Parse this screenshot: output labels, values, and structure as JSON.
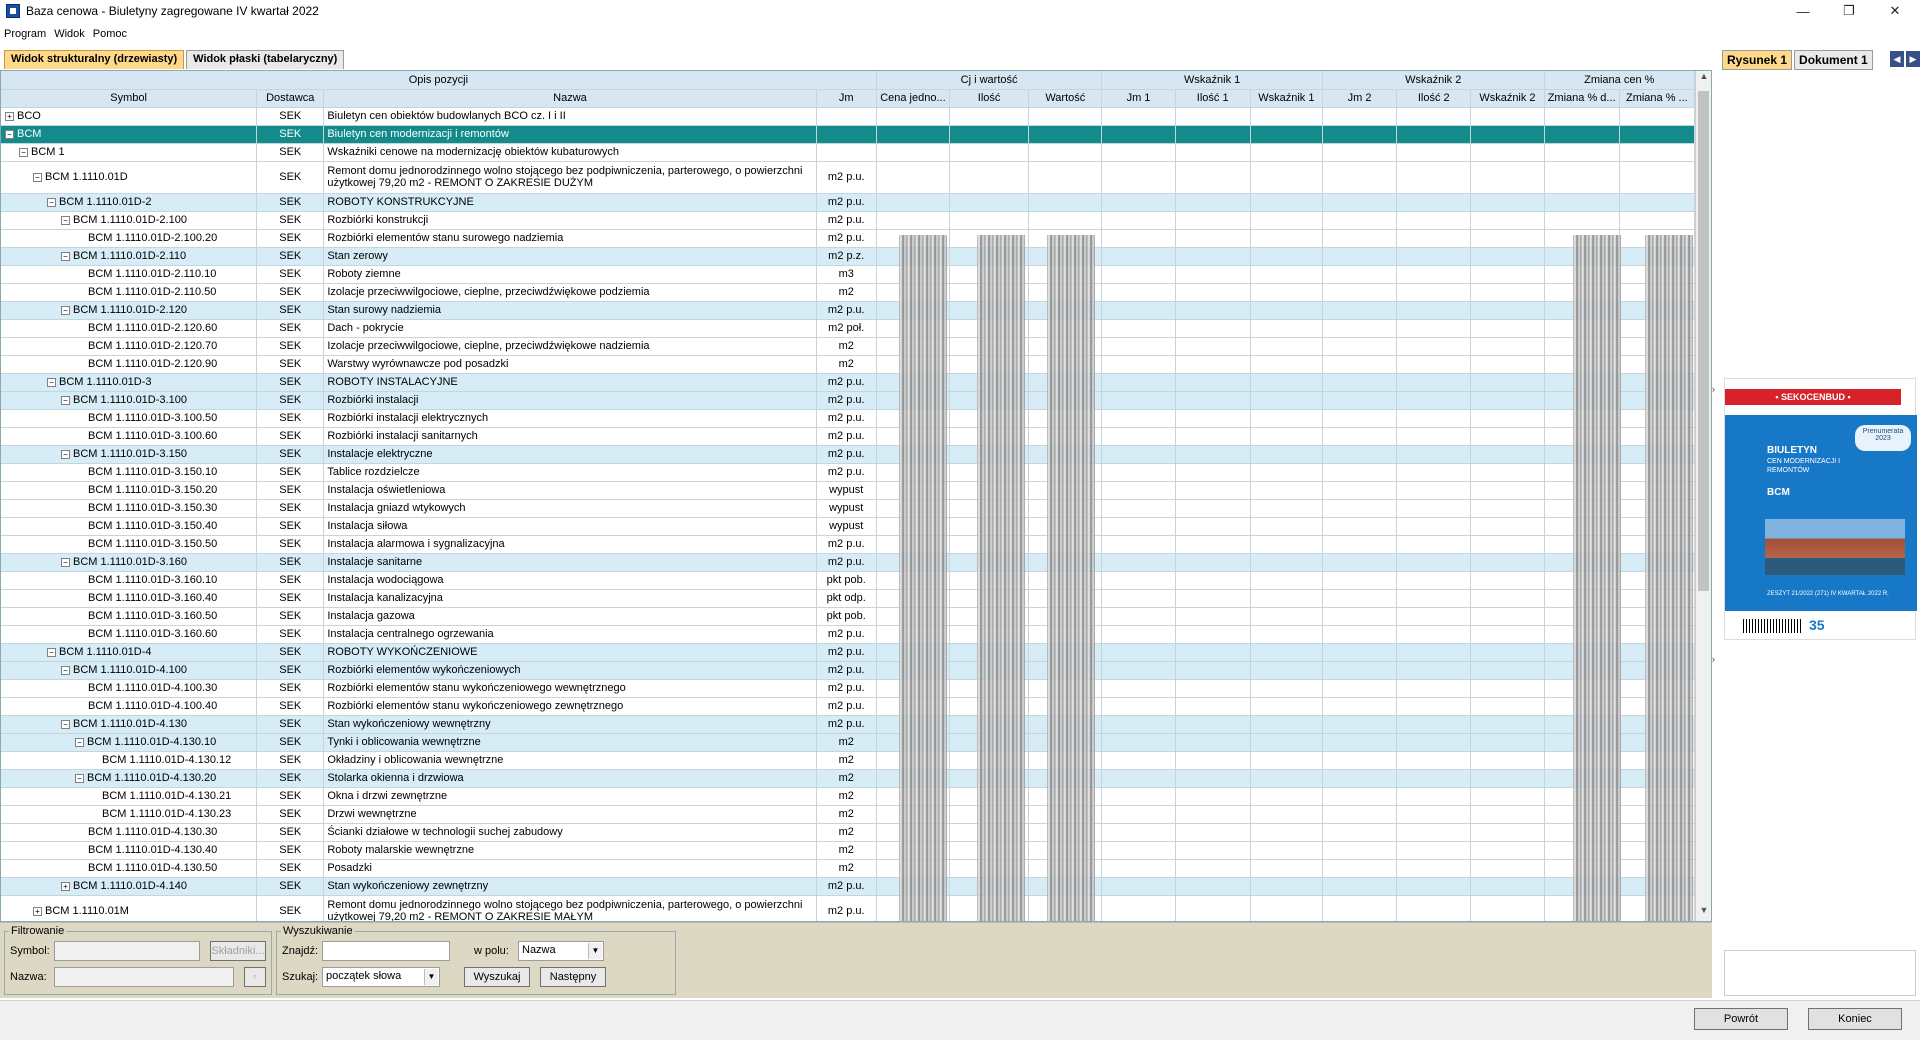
{
  "window": {
    "title": "Baza cenowa - Biuletyny zagregowane IV kwartał 2022",
    "controls": {
      "minimize": "—",
      "maximize": "❐",
      "close": "✕"
    }
  },
  "menu": [
    "Program",
    "Widok",
    "Pomoc"
  ],
  "tabs": [
    "Widok strukturalny (drzewiasty)",
    "Widok płaski (tabelaryczny)"
  ],
  "grid": {
    "group_headers": {
      "opis": "Opis pozycji",
      "cj": "Cj i wartość",
      "wsk1": "Wskaźnik 1",
      "wsk2": "Wskaźnik 2",
      "zmiana": "Zmiana cen %"
    },
    "columns": [
      "Symbol",
      "Dostawca",
      "Nazwa",
      "Jm",
      "Cena jedno...",
      "Ilość",
      "Wartość",
      "Jm 1",
      "Ilość 1",
      "Wskaźnik 1",
      "Jm 2",
      "Ilość 2",
      "Wskaźnik 2",
      "Zmiana % d...",
      "Zmiana % ..."
    ],
    "rows": [
      {
        "symbol": "BCO",
        "dostawca": "SEK",
        "nazwa": "Biuletyn cen obiektów budowlanych BCO cz. I i II",
        "jm": "",
        "exp": "+",
        "style": "row",
        "lvl": 0
      },
      {
        "symbol": "BCM",
        "dostawca": "SEK",
        "nazwa": "Biuletyn cen modernizacji i remontów",
        "jm": "",
        "exp": "−",
        "style": "sel",
        "lvl": 0
      },
      {
        "symbol": "BCM 1",
        "dostawca": "SEK",
        "nazwa": "Wskaźniki cenowe na modernizację obiektów kubaturowych",
        "jm": "",
        "exp": "−",
        "style": "row",
        "lvl": 1
      },
      {
        "symbol": "BCM 1.1110.01D",
        "dostawca": "SEK",
        "nazwa": "Remont domu jednorodzinnego wolno stojącego bez podpiwniczenia, parterowego, o powierzchni użytkowej 79,20 m2 - REMONT O ZAKRESIE DUŻYM",
        "jm": "m2 p.u.",
        "exp": "−",
        "style": "row tall",
        "lvl": 2
      },
      {
        "symbol": "BCM 1.1110.01D-2",
        "dostawca": "SEK",
        "nazwa": "ROBOTY KONSTRUKCYJNE",
        "jm": "m2 p.u.",
        "exp": "−",
        "style": "group",
        "lvl": 3
      },
      {
        "symbol": "BCM 1.1110.01D-2.100",
        "dostawca": "SEK",
        "nazwa": "Rozbiórki konstrukcji",
        "jm": "m2 p.u.",
        "exp": "−",
        "style": "row",
        "lvl": 4
      },
      {
        "symbol": "BCM 1.1110.01D-2.100.20",
        "dostawca": "SEK",
        "nazwa": "Rozbiórki elementów stanu surowego nadziemia",
        "jm": "m2 p.u.",
        "exp": "",
        "style": "row",
        "lvl": 5
      },
      {
        "symbol": "BCM 1.1110.01D-2.110",
        "dostawca": "SEK",
        "nazwa": "Stan zerowy",
        "jm": "m2 p.z.",
        "exp": "−",
        "style": "group",
        "lvl": 4
      },
      {
        "symbol": "BCM 1.1110.01D-2.110.10",
        "dostawca": "SEK",
        "nazwa": "Roboty ziemne",
        "jm": "m3",
        "exp": "",
        "style": "row",
        "lvl": 5
      },
      {
        "symbol": "BCM 1.1110.01D-2.110.50",
        "dostawca": "SEK",
        "nazwa": "Izolacje przeciwwilgociowe, cieplne, przeciwdźwiękowe podziemia",
        "jm": "m2",
        "exp": "",
        "style": "row",
        "lvl": 5
      },
      {
        "symbol": "BCM 1.1110.01D-2.120",
        "dostawca": "SEK",
        "nazwa": "Stan surowy nadziemia",
        "jm": "m2 p.u.",
        "exp": "−",
        "style": "group",
        "lvl": 4
      },
      {
        "symbol": "BCM 1.1110.01D-2.120.60",
        "dostawca": "SEK",
        "nazwa": "Dach - pokrycie",
        "jm": "m2 poł.",
        "exp": "",
        "style": "row",
        "lvl": 5
      },
      {
        "symbol": "BCM 1.1110.01D-2.120.70",
        "dostawca": "SEK",
        "nazwa": "Izolacje przeciwwilgociowe, cieplne, przeciwdźwiękowe nadziemia",
        "jm": "m2",
        "exp": "",
        "style": "row",
        "lvl": 5
      },
      {
        "symbol": "BCM 1.1110.01D-2.120.90",
        "dostawca": "SEK",
        "nazwa": "Warstwy wyrównawcze pod posadzki",
        "jm": "m2",
        "exp": "",
        "style": "row",
        "lvl": 5
      },
      {
        "symbol": "BCM 1.1110.01D-3",
        "dostawca": "SEK",
        "nazwa": "ROBOTY INSTALACYJNE",
        "jm": "m2 p.u.",
        "exp": "−",
        "style": "group",
        "lvl": 3
      },
      {
        "symbol": "BCM 1.1110.01D-3.100",
        "dostawca": "SEK",
        "nazwa": "Rozbiórki instalacji",
        "jm": "m2 p.u.",
        "exp": "−",
        "style": "group",
        "lvl": 4
      },
      {
        "symbol": "BCM 1.1110.01D-3.100.50",
        "dostawca": "SEK",
        "nazwa": "Rozbiórki instalacji elektrycznych",
        "jm": "m2 p.u.",
        "exp": "",
        "style": "row",
        "lvl": 5
      },
      {
        "symbol": "BCM 1.1110.01D-3.100.60",
        "dostawca": "SEK",
        "nazwa": "Rozbiórki instalacji sanitarnych",
        "jm": "m2 p.u.",
        "exp": "",
        "style": "row",
        "lvl": 5
      },
      {
        "symbol": "BCM 1.1110.01D-3.150",
        "dostawca": "SEK",
        "nazwa": "Instalacje elektryczne",
        "jm": "m2 p.u.",
        "exp": "−",
        "style": "group",
        "lvl": 4
      },
      {
        "symbol": "BCM 1.1110.01D-3.150.10",
        "dostawca": "SEK",
        "nazwa": "Tablice rozdzielcze",
        "jm": "m2 p.u.",
        "exp": "",
        "style": "row",
        "lvl": 5
      },
      {
        "symbol": "BCM 1.1110.01D-3.150.20",
        "dostawca": "SEK",
        "nazwa": "Instalacja oświetleniowa",
        "jm": "wypust",
        "exp": "",
        "style": "row",
        "lvl": 5
      },
      {
        "symbol": "BCM 1.1110.01D-3.150.30",
        "dostawca": "SEK",
        "nazwa": "Instalacja gniazd wtykowych",
        "jm": "wypust",
        "exp": "",
        "style": "row",
        "lvl": 5
      },
      {
        "symbol": "BCM 1.1110.01D-3.150.40",
        "dostawca": "SEK",
        "nazwa": "Instalacja siłowa",
        "jm": "wypust",
        "exp": "",
        "style": "row",
        "lvl": 5
      },
      {
        "symbol": "BCM 1.1110.01D-3.150.50",
        "dostawca": "SEK",
        "nazwa": "Instalacja alarmowa i sygnalizacyjna",
        "jm": "m2 p.u.",
        "exp": "",
        "style": "row",
        "lvl": 5
      },
      {
        "symbol": "BCM 1.1110.01D-3.160",
        "dostawca": "SEK",
        "nazwa": "Instalacje sanitarne",
        "jm": "m2 p.u.",
        "exp": "−",
        "style": "group",
        "lvl": 4
      },
      {
        "symbol": "BCM 1.1110.01D-3.160.10",
        "dostawca": "SEK",
        "nazwa": "Instalacja wodociągowa",
        "jm": "pkt pob.",
        "exp": "",
        "style": "row",
        "lvl": 5
      },
      {
        "symbol": "BCM 1.1110.01D-3.160.40",
        "dostawca": "SEK",
        "nazwa": "Instalacja kanalizacyjna",
        "jm": "pkt odp.",
        "exp": "",
        "style": "row",
        "lvl": 5
      },
      {
        "symbol": "BCM 1.1110.01D-3.160.50",
        "dostawca": "SEK",
        "nazwa": "Instalacja gazowa",
        "jm": "pkt pob.",
        "exp": "",
        "style": "row",
        "lvl": 5
      },
      {
        "symbol": "BCM 1.1110.01D-3.160.60",
        "dostawca": "SEK",
        "nazwa": "Instalacja centralnego ogrzewania",
        "jm": "m2 p.u.",
        "exp": "",
        "style": "row",
        "lvl": 5
      },
      {
        "symbol": "BCM 1.1110.01D-4",
        "dostawca": "SEK",
        "nazwa": "ROBOTY WYKOŃCZENIOWE",
        "jm": "m2 p.u.",
        "exp": "−",
        "style": "group",
        "lvl": 3
      },
      {
        "symbol": "BCM 1.1110.01D-4.100",
        "dostawca": "SEK",
        "nazwa": "Rozbiórki elementów wykończeniowych",
        "jm": "m2 p.u.",
        "exp": "−",
        "style": "group",
        "lvl": 4
      },
      {
        "symbol": "BCM 1.1110.01D-4.100.30",
        "dostawca": "SEK",
        "nazwa": "Rozbiórki elementów stanu wykończeniowego wewnętrznego",
        "jm": "m2 p.u.",
        "exp": "",
        "style": "row",
        "lvl": 5
      },
      {
        "symbol": "BCM 1.1110.01D-4.100.40",
        "dostawca": "SEK",
        "nazwa": "Rozbiórki elementów stanu wykończeniowego zewnętrznego",
        "jm": "m2 p.u.",
        "exp": "",
        "style": "row",
        "lvl": 5
      },
      {
        "symbol": "BCM 1.1110.01D-4.130",
        "dostawca": "SEK",
        "nazwa": "Stan wykończeniowy wewnętrzny",
        "jm": "m2 p.u.",
        "exp": "−",
        "style": "group",
        "lvl": 4
      },
      {
        "symbol": "BCM 1.1110.01D-4.130.10",
        "dostawca": "SEK",
        "nazwa": "Tynki i oblicowania wewnętrzne",
        "jm": "m2",
        "exp": "−",
        "style": "group",
        "lvl": 5
      },
      {
        "symbol": "BCM 1.1110.01D-4.130.12",
        "dostawca": "SEK",
        "nazwa": "Okładziny i oblicowania wewnętrzne",
        "jm": "m2",
        "exp": "",
        "style": "row",
        "lvl": 6
      },
      {
        "symbol": "BCM 1.1110.01D-4.130.20",
        "dostawca": "SEK",
        "nazwa": "Stolarka okienna i drzwiowa",
        "jm": "m2",
        "exp": "−",
        "style": "group",
        "lvl": 5
      },
      {
        "symbol": "BCM 1.1110.01D-4.130.21",
        "dostawca": "SEK",
        "nazwa": "Okna i drzwi zewnętrzne",
        "jm": "m2",
        "exp": "",
        "style": "row",
        "lvl": 6
      },
      {
        "symbol": "BCM 1.1110.01D-4.130.23",
        "dostawca": "SEK",
        "nazwa": "Drzwi wewnętrzne",
        "jm": "m2",
        "exp": "",
        "style": "row",
        "lvl": 6
      },
      {
        "symbol": "BCM 1.1110.01D-4.130.30",
        "dostawca": "SEK",
        "nazwa": "Ścianki działowe w technologii suchej zabudowy",
        "jm": "m2",
        "exp": "",
        "style": "row",
        "lvl": 5
      },
      {
        "symbol": "BCM 1.1110.01D-4.130.40",
        "dostawca": "SEK",
        "nazwa": "Roboty malarskie wewnętrzne",
        "jm": "m2",
        "exp": "",
        "style": "row",
        "lvl": 5
      },
      {
        "symbol": "BCM 1.1110.01D-4.130.50",
        "dostawca": "SEK",
        "nazwa": "Posadzki",
        "jm": "m2",
        "exp": "",
        "style": "row",
        "lvl": 5
      },
      {
        "symbol": "BCM 1.1110.01D-4.140",
        "dostawca": "SEK",
        "nazwa": "Stan wykończeniowy zewnętrzny",
        "jm": "m2 p.u.",
        "exp": "+",
        "style": "group",
        "lvl": 4
      },
      {
        "symbol": "BCM 1.1110.01M",
        "dostawca": "SEK",
        "nazwa": "Remont domu jednorodzinnego wolno stojącego bez podpiwniczenia, parterowego, o powierzchni użytkowej 79,20 m2 - REMONT O ZAKRESIE MAŁYM",
        "jm": "m2 p.u.",
        "exp": "+",
        "style": "row tall",
        "lvl": 2
      }
    ]
  },
  "filter": {
    "legend": "Filtrowanie",
    "symbol_label": "Symbol:",
    "nazwa_label": "Nazwa:",
    "skladniki_button": "Składniki...",
    "clear_button": "◦"
  },
  "search": {
    "legend": "Wyszukiwanie",
    "find_label": "Znajdź:",
    "field_label": "w polu:",
    "field_value": "Nazwa",
    "mode_label": "Szukaj:",
    "mode_value": "początek słowa",
    "search_button": "Wyszukaj",
    "next_button": "Następny"
  },
  "right_panel": {
    "tabs": [
      "Rysunek 1",
      "Dokument 1"
    ],
    "cover": {
      "header": "• SEKOCENBUD •",
      "title": "BIULETYN",
      "subtitle": "CEN MODERNIZACJI I REMONTÓW",
      "code": "BCM",
      "badge": "Prenumerata 2023",
      "footer": "ZESZYT 21/2022 (271)    IV KWARTAŁ 2022 R.",
      "number": "35"
    }
  },
  "footer_buttons": {
    "back": "Powrót",
    "end": "Koniec"
  }
}
